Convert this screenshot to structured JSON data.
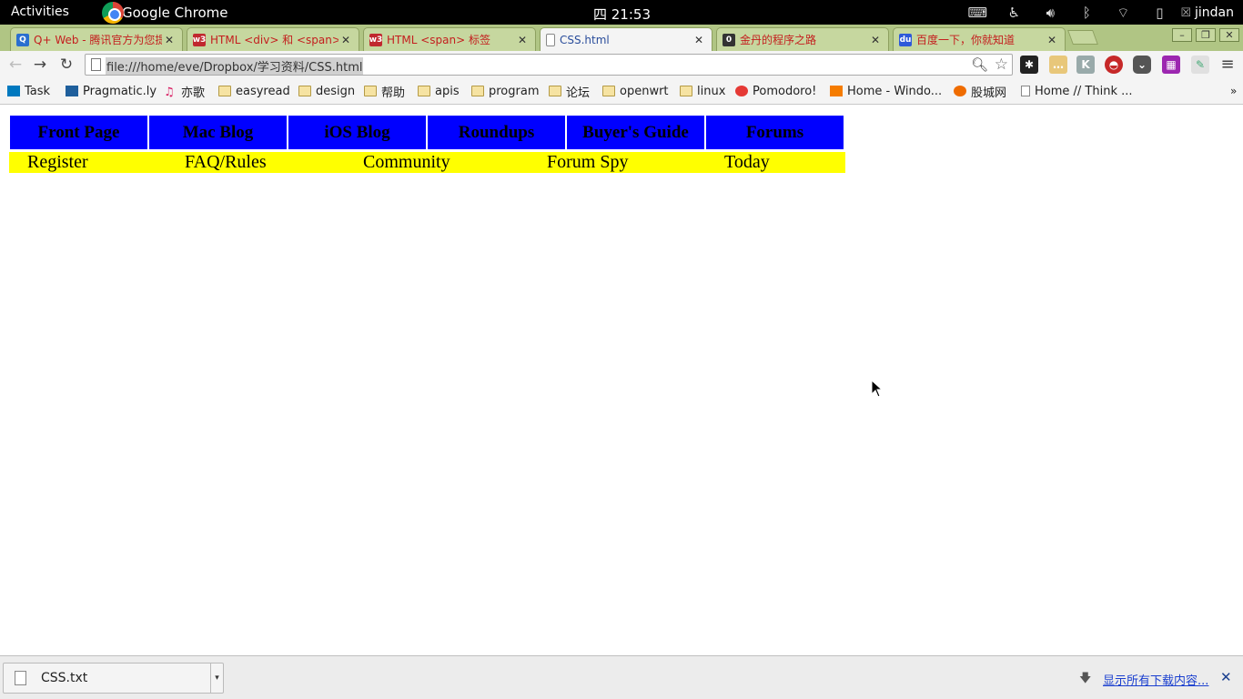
{
  "system_bar": {
    "activities": "Activities",
    "app_name": "Google Chrome",
    "clock": "四 21:53",
    "user": "jindan"
  },
  "tabs": [
    {
      "title": "Q+ Web - 腾讯官方为您提供",
      "favicon_text": "Q",
      "favicon_color": "#2a6fcf",
      "active": false
    },
    {
      "title": "HTML <div> 和 <span>",
      "favicon_text": "w3",
      "favicon_color": "#c0282e",
      "active": false
    },
    {
      "title": "HTML <span> 标签",
      "favicon_text": "w3",
      "favicon_color": "#c0282e",
      "active": false
    },
    {
      "title": "CSS.html",
      "favicon_text": "",
      "favicon_color": "#ffffff",
      "active": true
    },
    {
      "title": "金丹的程序之路",
      "favicon_text": "0",
      "favicon_color": "#333333",
      "active": false
    },
    {
      "title": "百度一下，你就知道",
      "favicon_text": "du",
      "favicon_color": "#2e59d9",
      "active": false
    }
  ],
  "toolbar": {
    "url": "file:///home/eve/Dropbox/学习资料/CSS.html"
  },
  "bookmarks": [
    {
      "label": "Task",
      "icon": "trello-icon",
      "color": "#0079bf"
    },
    {
      "label": "Pragmatic.ly",
      "icon": "pragmatic-icon",
      "color": "#1f5f9c"
    },
    {
      "label": "亦歌",
      "icon": "music-note-icon",
      "color": "#d81b60"
    },
    {
      "label": "easyread",
      "icon": "folder-icon",
      "color": ""
    },
    {
      "label": "design",
      "icon": "folder-icon",
      "color": ""
    },
    {
      "label": "帮助",
      "icon": "folder-icon",
      "color": ""
    },
    {
      "label": "apis",
      "icon": "folder-icon",
      "color": ""
    },
    {
      "label": "program",
      "icon": "folder-icon",
      "color": ""
    },
    {
      "label": "论坛",
      "icon": "folder-icon",
      "color": ""
    },
    {
      "label": "openwrt",
      "icon": "folder-icon",
      "color": ""
    },
    {
      "label": "linux",
      "icon": "folder-icon",
      "color": ""
    },
    {
      "label": "Pomodoro!",
      "icon": "tomato-icon",
      "color": "#e53935"
    },
    {
      "label": "Home - Windo...",
      "icon": "stack-icon",
      "color": "#f57c00"
    },
    {
      "label": "股城网",
      "icon": "swirl-icon",
      "color": "#ef6c00"
    },
    {
      "label": "Home // Think ...",
      "icon": "page-icon",
      "color": "#ffffff"
    }
  ],
  "page": {
    "primary_nav": [
      "Front Page",
      "Mac Blog",
      "iOS Blog",
      "Roundups",
      "Buyer's Guide",
      "Forums"
    ],
    "sub_nav": [
      "Register",
      "FAQ/Rules",
      "Community",
      "Forum Spy",
      "Today"
    ],
    "colors": {
      "primary_bg": "#0000ff",
      "sub_bg": "#ffff00"
    }
  },
  "download_shelf": {
    "file_name": "CSS.txt",
    "show_all": "显示所有下载内容..."
  }
}
